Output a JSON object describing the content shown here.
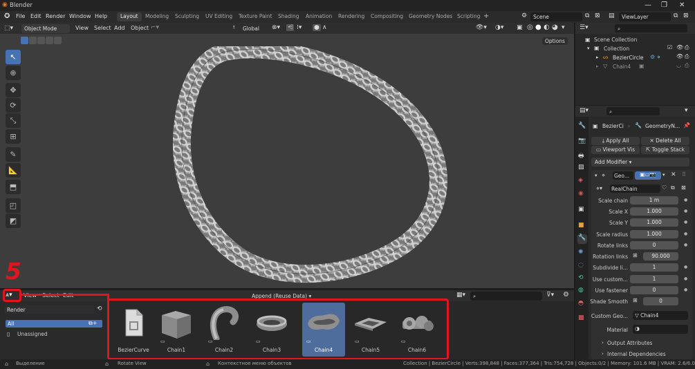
{
  "window": {
    "title": "Blender"
  },
  "menu": [
    "File",
    "Edit",
    "Render",
    "Window",
    "Help"
  ],
  "workspaces": [
    "Layout",
    "Modeling",
    "Sculpting",
    "UV Editing",
    "Texture Paint",
    "Shading",
    "Animation",
    "Rendering",
    "Compositing",
    "Geometry Nodes",
    "Scripting"
  ],
  "active_workspace": "Layout",
  "scene": {
    "name": "Scene",
    "view_layer": "ViewLayer"
  },
  "viewport_header": {
    "mode": "Object Mode",
    "view": "View",
    "select": "Select",
    "add": "Add",
    "object": "Object",
    "transform": "Global",
    "options": "Options"
  },
  "outliner": {
    "items": [
      {
        "label": "Scene Collection"
      },
      {
        "label": "Collection"
      },
      {
        "label": "BezierCircle"
      },
      {
        "label": "Chain4"
      }
    ]
  },
  "properties": {
    "breadcrumb": [
      "BezierCi",
      "GeometryN..."
    ],
    "apply_all": "Apply All",
    "delete_all": "Delete All",
    "viewport_vis": "Viewport Vis",
    "toggle_stack": "Toggle Stack",
    "add_modifier": "Add Modifier",
    "modifier_name": "Geo...",
    "node_group": "RealChain",
    "fields": [
      {
        "label": "Scale chain",
        "value": "1 m"
      },
      {
        "label": "Scale X",
        "value": "1.000"
      },
      {
        "label": "Scale Y",
        "value": "1.000"
      },
      {
        "label": "Scale radius",
        "value": "1.000"
      },
      {
        "label": "Rotate links",
        "value": "0"
      },
      {
        "label": "Rotation links",
        "value": "90.000"
      },
      {
        "label": "Subdivide li...",
        "value": "1"
      },
      {
        "label": "Use custom...",
        "value": "1"
      },
      {
        "label": "Use fastener",
        "value": "0"
      },
      {
        "label": "Shade Smooth",
        "value": "0"
      }
    ],
    "custom_geo_label": "Custom Geo...",
    "custom_geo_value": "Chain4",
    "material_label": "Material",
    "output_attributes": "Output Attributes",
    "internal_dependencies": "Internal Dependencies"
  },
  "asset_browser": {
    "menu": [
      "View",
      "Select",
      "Edit"
    ],
    "import_mode": "Append (Reuse Data)",
    "library": "Render",
    "catalog_all": "All",
    "catalog_unassigned": "Unassigned",
    "assets": [
      "BezierCurve",
      "Chain1",
      "Chain2",
      "Chain3",
      "Chain4",
      "Chain5",
      "Chain6"
    ],
    "selected": "Chain4"
  },
  "annotation": {
    "step": "5"
  },
  "status": {
    "left": "Выделение",
    "mid": "Rotate View",
    "mid2": "Контекстное меню объектов",
    "right": "Collection | BezierCircle | Verts:398,848 | Faces:377,364 | Tris:754,728 | Objects:0/2 | Memory: 101.6 MB | VRAM: 2.6/6.0 GB"
  },
  "colors": {
    "accent": "#4772b3",
    "annotation_red": "#e0161e",
    "selected_asset": "#4e6d9c"
  }
}
